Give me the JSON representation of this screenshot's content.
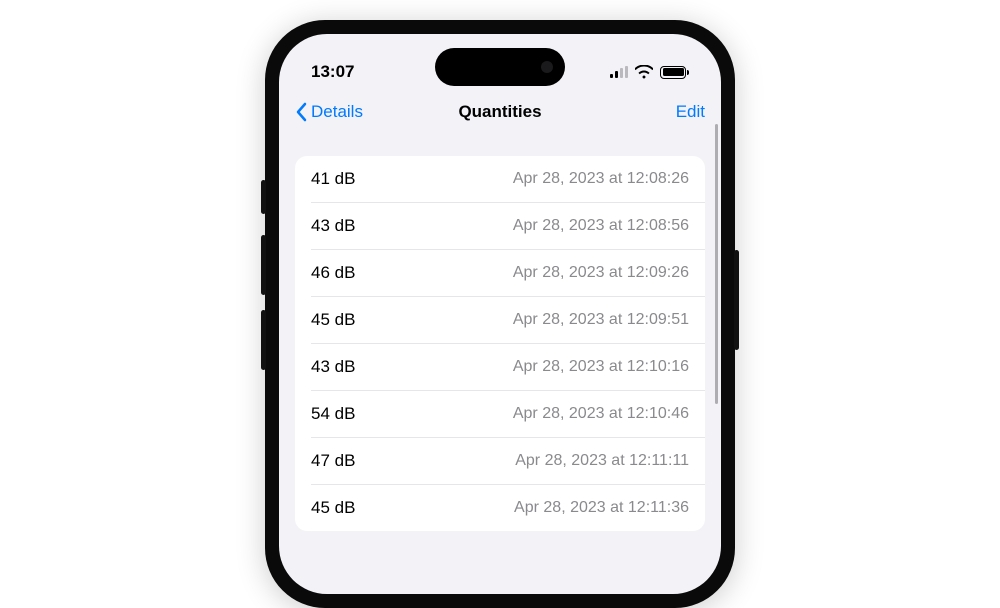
{
  "status": {
    "time": "13:07"
  },
  "nav": {
    "back_label": "Details",
    "title": "Quantities",
    "action_label": "Edit"
  },
  "rows": [
    {
      "value": "41 dB",
      "ts": "Apr 28, 2023 at 12:08:26"
    },
    {
      "value": "43 dB",
      "ts": "Apr 28, 2023 at 12:08:56"
    },
    {
      "value": "46 dB",
      "ts": "Apr 28, 2023 at 12:09:26"
    },
    {
      "value": "45 dB",
      "ts": "Apr 28, 2023 at 12:09:51"
    },
    {
      "value": "43 dB",
      "ts": "Apr 28, 2023 at 12:10:16"
    },
    {
      "value": "54 dB",
      "ts": "Apr 28, 2023 at 12:10:46"
    },
    {
      "value": "47 dB",
      "ts": "Apr 28, 2023 at 12:11:11"
    },
    {
      "value": "45 dB",
      "ts": "Apr 28, 2023 at 12:11:36"
    }
  ]
}
